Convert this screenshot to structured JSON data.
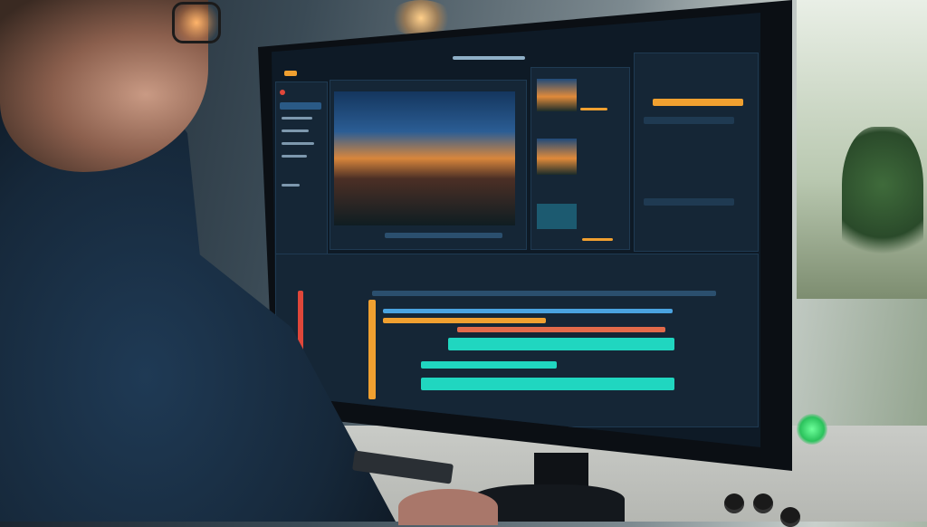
{
  "scene": {
    "description_colors": {
      "screen_bg": "#0e1a26",
      "accent_orange": "#f0a030",
      "accent_teal": "#20d6c0",
      "accent_blue": "#4aa3e0",
      "status_light": "#2bc25c"
    }
  },
  "editor": {
    "preview_label": "",
    "right_panel_title": "",
    "timeline_label": ""
  }
}
